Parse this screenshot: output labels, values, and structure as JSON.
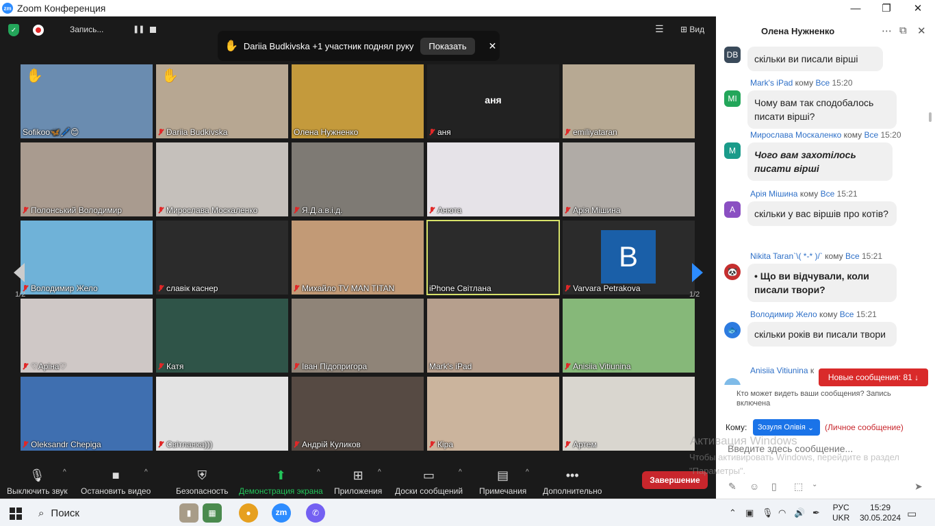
{
  "window": {
    "title": "Zoom Конференция",
    "minimize": "—",
    "maximize": "❐",
    "close": "✕",
    "app_badge": "zm"
  },
  "topbar": {
    "record_label": "Запись...",
    "pause": "❚❚",
    "view_label": "Вид"
  },
  "notification": {
    "text": "Dariia Budkivska +1 участник поднял руку",
    "show_button": "Показать",
    "close": "✕"
  },
  "page_indicator": "1/2",
  "tiles": [
    {
      "name": "Sofikoo🦋🖊️😊",
      "raised": true,
      "muted": false,
      "bg": "#6a8cb0"
    },
    {
      "name": "Dariia Budkivska",
      "raised": true,
      "muted": true,
      "bg": "#b7a792"
    },
    {
      "name": "Олена Нужненко",
      "raised": false,
      "muted": false,
      "bg": "#c49a3c"
    },
    {
      "name": "аня",
      "raised": false,
      "muted": true,
      "bg": "#222222",
      "avatar_text": "аня"
    },
    {
      "name": "emiliyataran",
      "raised": false,
      "muted": true,
      "bg": "#b7a993"
    },
    {
      "name": "Полонський Володимир",
      "raised": false,
      "muted": true,
      "bg": "#a99b8f"
    },
    {
      "name": "Мирослава Москаленко",
      "raised": false,
      "muted": true,
      "bg": "#c5c0bb"
    },
    {
      "name": "Я.Д.а.в.і.д.",
      "raised": false,
      "muted": true,
      "bg": "#7e7a74"
    },
    {
      "name": "Анюта",
      "raised": false,
      "muted": true,
      "bg": "#e6e3e8"
    },
    {
      "name": "Арія Мішина",
      "raised": false,
      "muted": true,
      "bg": "#b0aba6"
    },
    {
      "name": "Володимир Жело",
      "raised": false,
      "muted": true,
      "bg": "#6fb2d8"
    },
    {
      "name": "славік каснер",
      "raised": false,
      "muted": true,
      "bg": "#2b2b2b"
    },
    {
      "name": "Михайло TV MAN TITAN",
      "raised": false,
      "muted": true,
      "bg": "#c29a76"
    },
    {
      "name": "iPhone Світлана",
      "raised": false,
      "muted": false,
      "bg": "#2b2b2b",
      "selected": true
    },
    {
      "name": "Varvara Petrakova",
      "raised": false,
      "muted": true,
      "bg": "#2b2b2b",
      "letter": "B"
    },
    {
      "name": "♡Аріна♡",
      "raised": false,
      "muted": true,
      "bg": "#cfc8c6"
    },
    {
      "name": "Катя",
      "raised": false,
      "muted": true,
      "bg": "#2f5448"
    },
    {
      "name": "Іван Підопригора",
      "raised": false,
      "muted": true,
      "bg": "#8f8478"
    },
    {
      "name": "Mark's iPad",
      "raised": false,
      "muted": false,
      "bg": "#b69f8d"
    },
    {
      "name": "Anisiia Vitiunina",
      "raised": false,
      "muted": true,
      "bg": "#86b879"
    },
    {
      "name": "Oleksandr Chepiga",
      "raised": false,
      "muted": true,
      "bg": "#3f6fb0"
    },
    {
      "name": "Світланка)))",
      "raised": false,
      "muted": true,
      "bg": "#e3e3e3"
    },
    {
      "name": "Андрій Куликов",
      "raised": false,
      "muted": true,
      "bg": "#564a43"
    },
    {
      "name": "Кіра",
      "raised": false,
      "muted": true,
      "bg": "#cbb49d"
    },
    {
      "name": "Артем",
      "raised": false,
      "muted": true,
      "bg": "#d9d6cf"
    }
  ],
  "toolbar": {
    "mute": "Выключить звук",
    "video": "Остановить видео",
    "security": "Безопасность",
    "share": "Демонстрация экрана",
    "apps": "Приложения",
    "whiteboard": "Доски сообщений",
    "notes": "Примечания",
    "more": "Дополнительно",
    "end": "Завершение",
    "caret": "^"
  },
  "chat": {
    "title": "Олена Нужненко",
    "first_msg": {
      "avatar": "DB",
      "color": "#3a4a5a",
      "text": "скільки ви писали вірші"
    },
    "messages": [
      {
        "sender": "Mark's iPad",
        "to": "кому",
        "target": "Все",
        "time": "15:20",
        "avatar": "MI",
        "color": "#23a65a",
        "text": "Чому вам так сподобалось писати вірші?"
      },
      {
        "sender": "Мирослава Москаленко",
        "to": "кому",
        "target": "Все",
        "time": "15:20",
        "avatar": "M",
        "color": "#1a9b8a",
        "text": "Чого вам захотілось писати вірші"
      },
      {
        "sender": "Арія Мішина",
        "to": "кому",
        "target": "Все",
        "time": "15:21",
        "avatar": "A",
        "color": "#8a4fc2",
        "text": "скільки у вас віршів про котів?"
      },
      {
        "sender": "Nikita Taran`\\( *-* )/`",
        "to": "кому",
        "target": "Все",
        "time": "15:21",
        "avatar": "🐼",
        "color": "#c62f2f",
        "text": "Що ви відчували, коли писали твори?"
      },
      {
        "sender": "Володимир Жело",
        "to": "кому",
        "target": "Все",
        "time": "15:21",
        "avatar": "🐟",
        "color": "#2d7be0",
        "text": "скільки років ви писали твори"
      },
      {
        "sender": "Anisiia Vitiunina",
        "to": "к",
        "target": "",
        "time": "",
        "avatar": "",
        "color": "#7fbbe8",
        "text": ""
      }
    ],
    "new_messages": "Новые сообщения: 81 ↓",
    "who_can_see": "Кто может видеть ваши сообщения? Запись включена",
    "to_label": "Кому:",
    "recipient": "Зозуля Олівія",
    "private": "(Личное сообщение)",
    "input_placeholder": "Введите здесь сообщение..."
  },
  "watermark": {
    "title": "Активация Windows",
    "text": "Чтобы активировать Windows, перейдите в раздел \"Параметры\"."
  },
  "taskbar": {
    "search": "Поиск",
    "lang_top": "РУС",
    "lang_bottom": "UKR",
    "time": "15:29",
    "date": "30.05.2024"
  }
}
